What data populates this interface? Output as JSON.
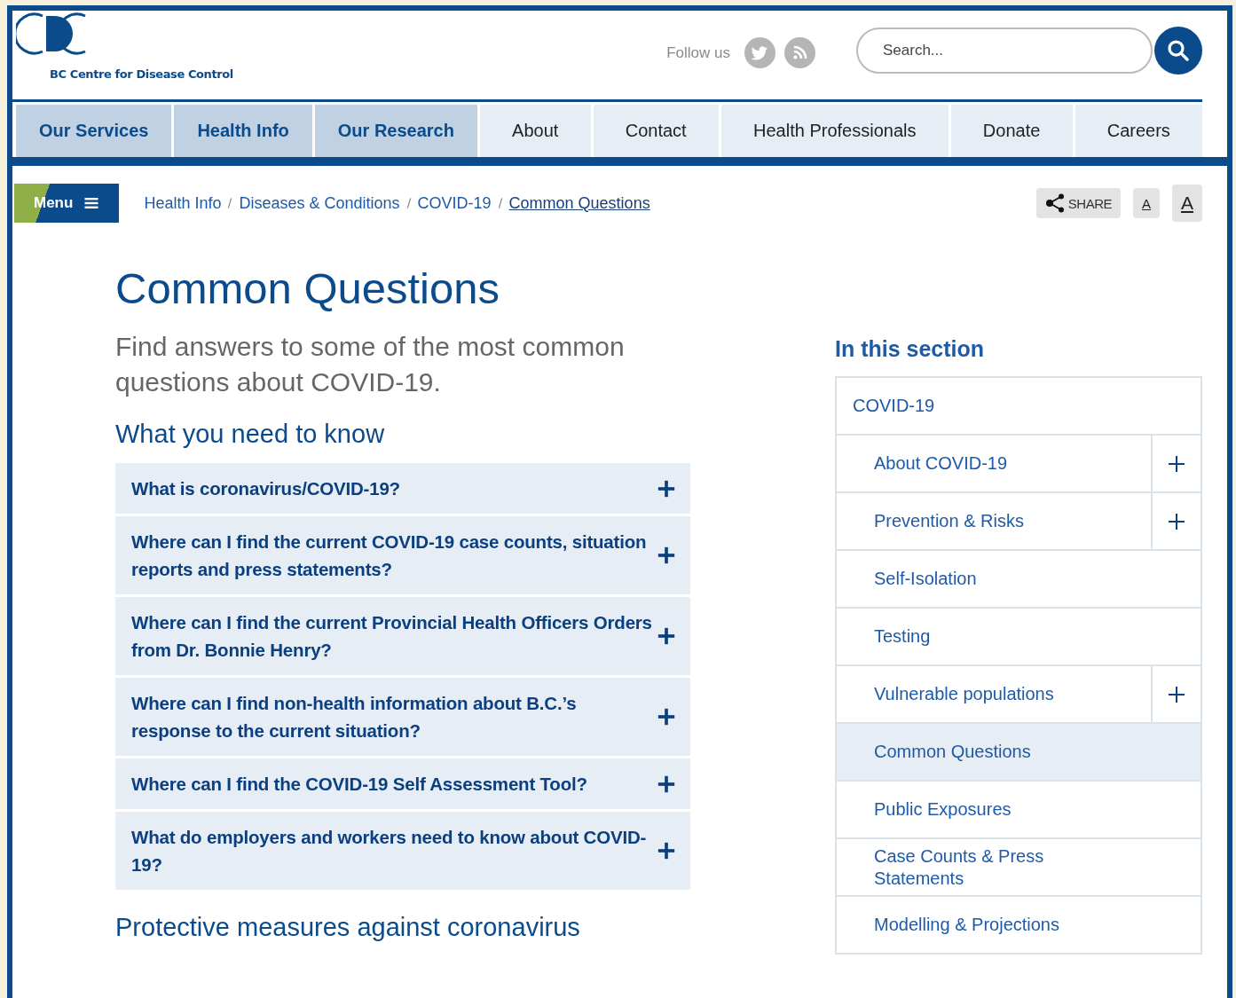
{
  "header": {
    "logo_text": "BC Centre for Disease Control",
    "follow_label": "Follow us",
    "search": {
      "placeholder": "Search..."
    }
  },
  "nav": [
    {
      "label": "Our Services",
      "kind": "primary"
    },
    {
      "label": "Health Info",
      "kind": "primary"
    },
    {
      "label": "Our Research",
      "kind": "primary"
    },
    {
      "label": "About",
      "kind": "secondary"
    },
    {
      "label": "Contact",
      "kind": "secondary"
    },
    {
      "label": "Health Professionals",
      "kind": "secondary"
    },
    {
      "label": "Donate",
      "kind": "secondary"
    },
    {
      "label": "Careers",
      "kind": "secondary"
    }
  ],
  "menu_button": "Menu",
  "breadcrumb": [
    {
      "label": "Health Info",
      "current": false
    },
    {
      "label": "Diseases & Conditions",
      "current": false
    },
    {
      "label": "COVID-19",
      "current": false
    },
    {
      "label": "Common Questions",
      "current": true
    }
  ],
  "tools": {
    "share": "SHARE",
    "font_small": "A",
    "font_large": "A"
  },
  "main": {
    "title": "Common Questions",
    "intro": "Find answers to some of the most common questions about COVID-19.",
    "sections": [
      {
        "heading": "What you need to know",
        "questions": [
          {
            "text": "What is coronavirus/COVID-19?",
            "expanded": false
          },
          {
            "text": "Where can I find the current COVID-19 case counts, situation reports and press statements?",
            "expanded": false
          },
          {
            "text": "Where can I find the current Provincial Health Officers Orders from Dr. Bonnie Henry?",
            "expanded": false
          },
          {
            "text": "Where can I find non-health information about B.C.’s response to the current situation?",
            "expanded": false
          },
          {
            "text": "Where can I find the COVID-19 Self Assessment Tool?",
            "expanded": false
          },
          {
            "text": "What do employers and workers need to know about COVID-19?",
            "expanded": false
          }
        ]
      },
      {
        "heading": "Protective measures against coronavirus"
      }
    ]
  },
  "sidebar": {
    "heading": "In this section",
    "items": [
      {
        "label": "COVID-19",
        "kind": "parent",
        "selected": false,
        "expandable": false
      },
      {
        "label": "About COVID-19",
        "kind": "child",
        "selected": false,
        "expandable": true
      },
      {
        "label": "Prevention & Risks",
        "kind": "child",
        "selected": false,
        "expandable": true
      },
      {
        "label": "Self-Isolation",
        "kind": "child",
        "selected": false,
        "expandable": false
      },
      {
        "label": "Testing",
        "kind": "child",
        "selected": false,
        "expandable": false
      },
      {
        "label": "Vulnerable populations",
        "kind": "child",
        "selected": false,
        "expandable": true
      },
      {
        "label": "Common Questions",
        "kind": "child",
        "selected": true,
        "expandable": false
      },
      {
        "label": "Public Exposures",
        "kind": "child",
        "selected": false,
        "expandable": false
      },
      {
        "label": "Case Counts & Press Statements",
        "kind": "child",
        "selected": false,
        "expandable": false
      },
      {
        "label": "Modelling & Projections",
        "kind": "child",
        "selected": false,
        "expandable": false
      }
    ]
  }
}
